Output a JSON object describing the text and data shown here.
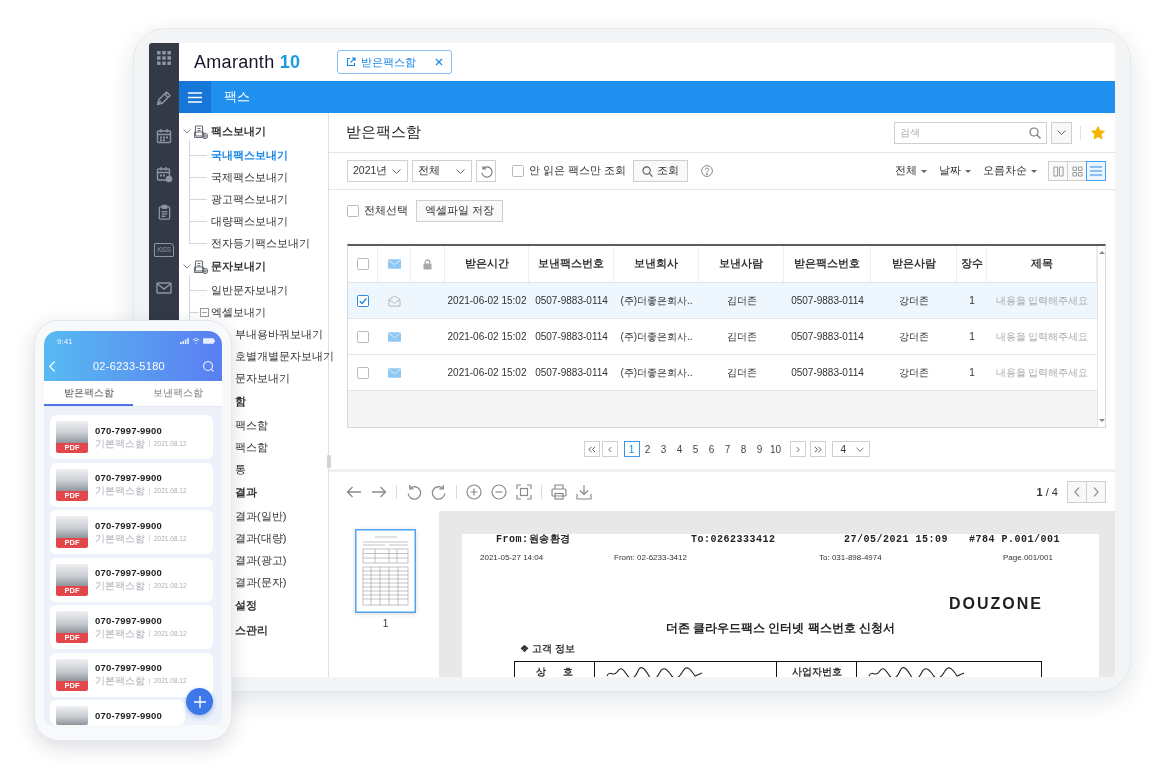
{
  "app": {
    "logo": {
      "name": "Amaranth",
      "version": "10"
    },
    "tabs": [
      {
        "label": "받은팩스함",
        "selected": true
      }
    ],
    "module_title": "팩스",
    "rail_kiss_label": "KiSS"
  },
  "tree": [
    {
      "label": "팩스보내기",
      "expanded": true,
      "children": [
        {
          "label": "국내팩스보내기",
          "selected": true
        },
        {
          "label": "국제팩스보내기",
          "selected": false
        },
        {
          "label": "광고팩스보내기",
          "selected": false
        },
        {
          "label": "대량팩스보내기",
          "selected": false
        },
        {
          "label": "전자등기팩스보내기",
          "selected": false
        }
      ]
    },
    {
      "label": "문자보내기",
      "expanded": true,
      "children": [
        {
          "label": "일반문자보내기",
          "selected": false
        },
        {
          "label": "엑셀보내기",
          "selected": false,
          "expanded": true,
          "children": [
            {
              "label": "부내용바꿔보내기",
              "selected": false,
              "partly_covered": true
            },
            {
              "label": "호별개별문자보내기",
              "selected": false,
              "partly_covered": true
            },
            {
              "label": "문자보내기",
              "selected": false,
              "partly_covered": true
            }
          ]
        }
      ]
    },
    {
      "label": "함",
      "partly_covered": true,
      "children": [
        {
          "label": "팩스함",
          "selected": false,
          "partly_covered": true
        },
        {
          "label": "팩스함",
          "selected": false,
          "partly_covered": true
        },
        {
          "label": "통",
          "selected": false,
          "partly_covered": true
        }
      ]
    },
    {
      "label": "결과",
      "partly_covered": true,
      "children": [
        {
          "label": "결과(일반)",
          "selected": false,
          "partly_covered": true
        },
        {
          "label": "결과(대량)",
          "selected": false,
          "partly_covered": true
        },
        {
          "label": "결과(광고)",
          "selected": false,
          "partly_covered": true
        },
        {
          "label": "결과(문자)",
          "selected": false,
          "partly_covered": true
        }
      ]
    },
    {
      "label": "설정",
      "partly_covered": true
    },
    {
      "label": "스관리",
      "partly_covered": true
    }
  ],
  "inbox": {
    "title": "받은팩스함",
    "search": {
      "placeholder": "검색"
    },
    "favorite": true,
    "filters": {
      "year": "2021년",
      "category": "전체",
      "unread_only": {
        "label": "안 읽은 팩스만 조회",
        "checked": false
      },
      "search_button": "조회"
    },
    "sort_menus": [
      "전체",
      "날짜",
      "오름차순"
    ],
    "view_modes": [
      {
        "kind": "columns",
        "selected": false
      },
      {
        "kind": "grid",
        "selected": false
      },
      {
        "kind": "list",
        "selected": true
      }
    ],
    "select_all": {
      "label": "전체선택",
      "checked": false
    },
    "export_button": "엑셀파일 저장",
    "table": {
      "all_checked": false,
      "columns": [
        "받은시간",
        "보낸팩스번호",
        "보낸회사",
        "보낸사람",
        "받은팩스번호",
        "받은사람",
        "장수",
        "제목"
      ],
      "rows": [
        {
          "selected": true,
          "checked": true,
          "read": true,
          "received": "2021-06-02 15:02",
          "sender_fax": "0507-9883-0114",
          "sender_company": "(주)더좋은회사..",
          "sender_name": "김더존",
          "receiver_fax": "0507-9883-0114",
          "receiver_name": "강더존",
          "pages": "1",
          "subject_placeholder": "내용을 입력해주세요"
        },
        {
          "selected": false,
          "checked": false,
          "read": false,
          "received": "2021-06-02 15:02",
          "sender_fax": "0507-9883-0114",
          "sender_company": "(주)더좋은회사..",
          "sender_name": "김더존",
          "receiver_fax": "0507-9883-0114",
          "receiver_name": "강더존",
          "pages": "1",
          "subject_placeholder": "내용을 입력해주세요"
        },
        {
          "selected": false,
          "checked": false,
          "read": false,
          "received": "2021-06-02 15:02",
          "sender_fax": "0507-9883-0114",
          "sender_company": "(주)더좋은회사..",
          "sender_name": "김더존",
          "receiver_fax": "0507-9883-0114",
          "receiver_name": "강더존",
          "pages": "1",
          "subject_placeholder": "내용을 입력해주세요"
        }
      ]
    },
    "pagination": {
      "pages": [
        {
          "label": "1",
          "selected": true
        },
        {
          "label": "2",
          "selected": false
        },
        {
          "label": "3",
          "selected": false
        },
        {
          "label": "4",
          "selected": false
        },
        {
          "label": "5",
          "selected": false
        },
        {
          "label": "6",
          "selected": false
        },
        {
          "label": "7",
          "selected": false
        },
        {
          "label": "8",
          "selected": false
        },
        {
          "label": "9",
          "selected": false
        },
        {
          "label": "10",
          "selected": false
        }
      ],
      "page_size": "4"
    }
  },
  "viewer": {
    "page_indicator": "**1** / 4",
    "thumbnails": [
      {
        "label": "1",
        "selected": true
      }
    ],
    "document": {
      "fax_header": [
        "From:원송환경",
        "To:0262333412",
        "27/05/2021 15:09",
        "#784 P.001/001"
      ],
      "transmission_info": [
        "2021-05-27 14:04",
        "From: 02-6233-3412",
        "To: 031-898-4974",
        "Page.001/001"
      ],
      "company_logo": "DOUZONE",
      "title": "더존 클라우드팩스 인터넷 팩스번호 신청서",
      "section": "❖ 고객 정보",
      "fields": [
        "상 호",
        "사업자번호"
      ]
    }
  },
  "phone": {
    "time": "9:41",
    "title": "02-6233-5180",
    "tabs": [
      {
        "label": "받은팩스함",
        "selected": true
      },
      {
        "label": "보낸팩스함",
        "selected": false
      }
    ],
    "items": [
      {
        "number": "070-7997-9900",
        "folder": "기본팩스함",
        "date": "2021.08.12",
        "file_type": "PDF"
      },
      {
        "number": "070-7997-9900",
        "folder": "기본팩스함",
        "date": "2021.08.12",
        "file_type": "PDF"
      },
      {
        "number": "070-7997-9900",
        "folder": "기본팩스함",
        "date": "2021.08.12",
        "file_type": "PDF"
      },
      {
        "number": "070-7997-9900",
        "folder": "기본팩스함",
        "date": "2021.08.12",
        "file_type": "PDF"
      },
      {
        "number": "070-7997-9900",
        "folder": "기본팩스함",
        "date": "2021.08.12",
        "file_type": "PDF"
      },
      {
        "number": "070-7997-9900",
        "folder": "기본팩스함",
        "date": "2021.08.12",
        "file_type": "PDF"
      },
      {
        "number": "070-7997-9900"
      }
    ]
  }
}
